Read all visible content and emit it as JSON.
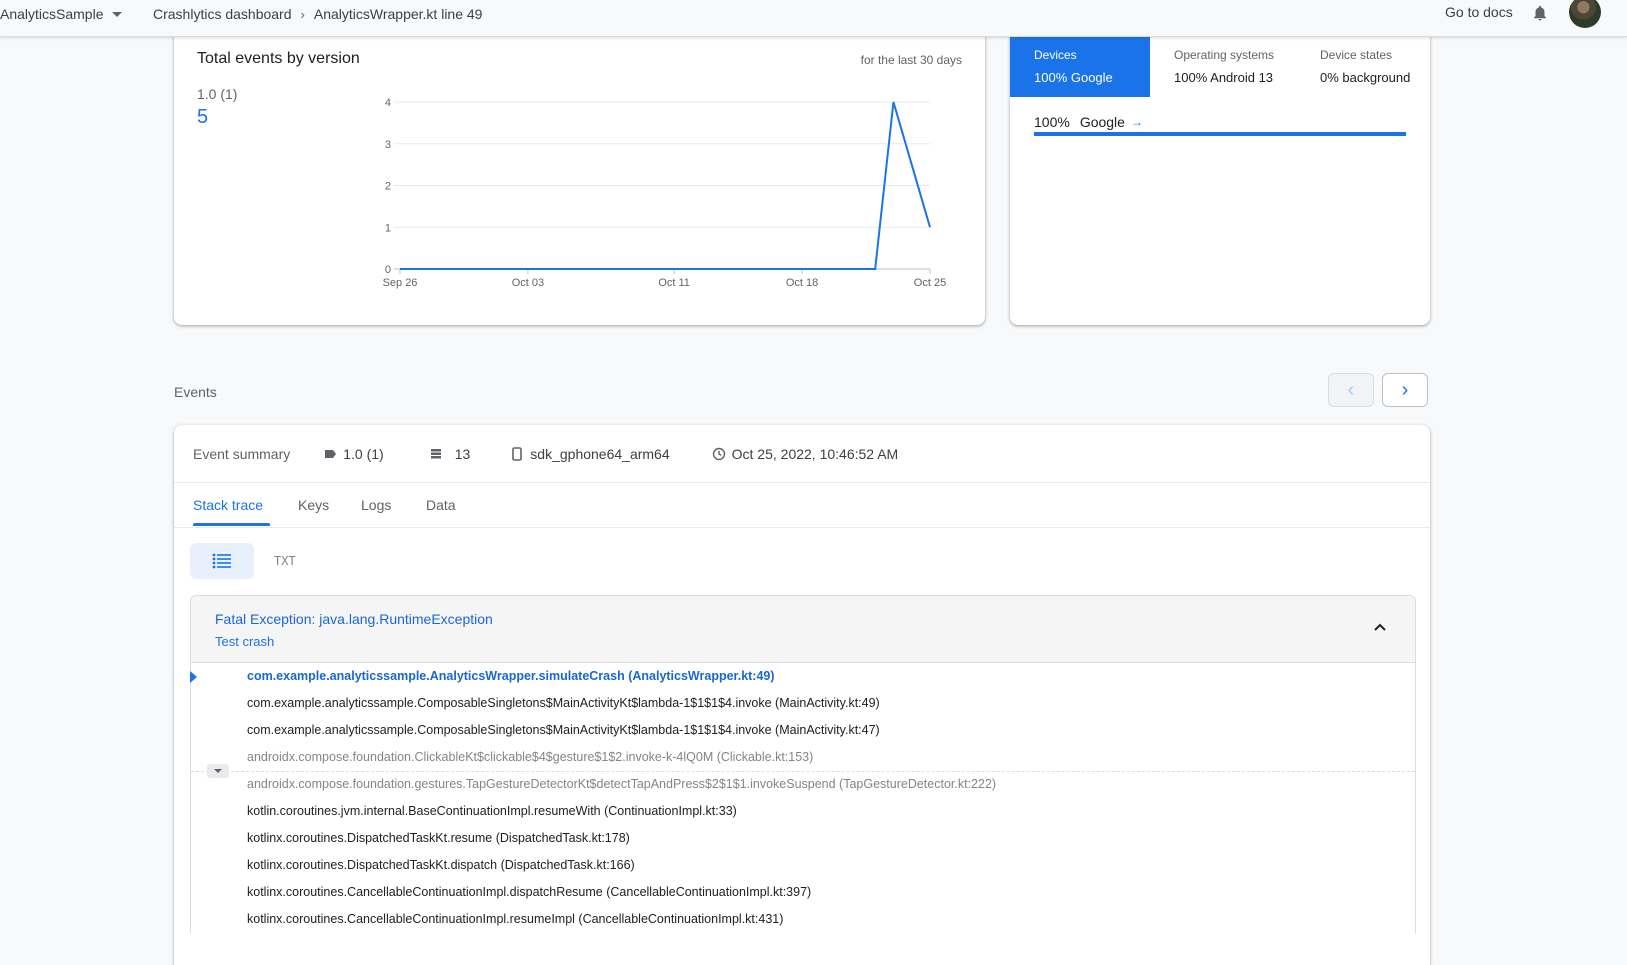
{
  "topbar": {
    "app_name": "AnalyticsSample",
    "breadcrumb_parent": "Crashlytics dashboard",
    "breadcrumb_current": "AnalyticsWrapper.kt line 49",
    "docs_label": "Go to docs"
  },
  "chart_card": {
    "title": "Total events by version",
    "range_label": "for the last 30 days",
    "legend_version": "1.0 (1)",
    "legend_count": "5"
  },
  "chart_data": {
    "type": "line",
    "title": "Total events by version",
    "x_tick_labels": [
      "Sep 26",
      "Oct 03",
      "Oct 11",
      "Oct 18",
      "Oct 25"
    ],
    "x": [
      "Sep 26",
      "Oct 22",
      "Oct 23",
      "Oct 25"
    ],
    "series": [
      {
        "name": "1.0 (1)",
        "values": [
          0,
          0,
          4,
          1
        ],
        "color": "#1a73e8"
      }
    ],
    "ylim": [
      0,
      4
    ],
    "y_ticks": [
      0,
      1,
      2,
      3,
      4
    ],
    "grid": true
  },
  "distribution": {
    "tabs": [
      {
        "title": "Devices",
        "value": "100% Google"
      },
      {
        "title": "Operating systems",
        "value": "100% Android 13"
      },
      {
        "title": "Device states",
        "value": "0% background"
      }
    ],
    "row_pct": "100%",
    "row_label": "Google",
    "row_fraction": 1.0,
    "accent": "#1a73e8"
  },
  "events": {
    "label": "Events",
    "prev_icon": "chevron-left-icon",
    "next_icon": "chevron-right-icon"
  },
  "event_summary": {
    "label": "Event summary",
    "version": "1.0 (1)",
    "version_icon": "label-tag-icon",
    "count": "13",
    "count_icon": "stack-layers-icon",
    "device": "sdk_gphone64_arm64",
    "device_icon": "phone-icon",
    "timestamp": "Oct 25, 2022, 10:46:52 AM",
    "timestamp_icon": "clock-icon"
  },
  "tabs": [
    "Stack trace",
    "Keys",
    "Logs",
    "Data"
  ],
  "view_toggle": {
    "list_icon": "list-icon",
    "txt_label": "TXT"
  },
  "exception": {
    "title": "Fatal Exception: java.lang.RuntimeException",
    "message": "Test crash",
    "frames": [
      "com.example.analyticssample.AnalyticsWrapper.simulateCrash (AnalyticsWrapper.kt:49)",
      "com.example.analyticssample.ComposableSingletons$MainActivityKt$lambda-1$1$1$4.invoke (MainActivity.kt:49)",
      "com.example.analyticssample.ComposableSingletons$MainActivityKt$lambda-1$1$1$4.invoke (MainActivity.kt:47)",
      "androidx.compose.foundation.ClickableKt$clickable$4$gesture$1$2.invoke-k-4lQ0M (Clickable.kt:153)",
      "androidx.compose.foundation.gestures.TapGestureDetectorKt$detectTapAndPress$2$1$1.invokeSuspend (TapGestureDetector.kt:222)",
      "kotlin.coroutines.jvm.internal.BaseContinuationImpl.resumeWith (ContinuationImpl.kt:33)",
      "kotlinx.coroutines.DispatchedTaskKt.resume (DispatchedTask.kt:178)",
      "kotlinx.coroutines.DispatchedTaskKt.dispatch (DispatchedTask.kt:166)",
      "kotlinx.coroutines.CancellableContinuationImpl.dispatchResume (CancellableContinuationImpl.kt:397)",
      "kotlinx.coroutines.CancellableContinuationImpl.resumeImpl (CancellableContinuationImpl.kt:431)"
    ]
  }
}
